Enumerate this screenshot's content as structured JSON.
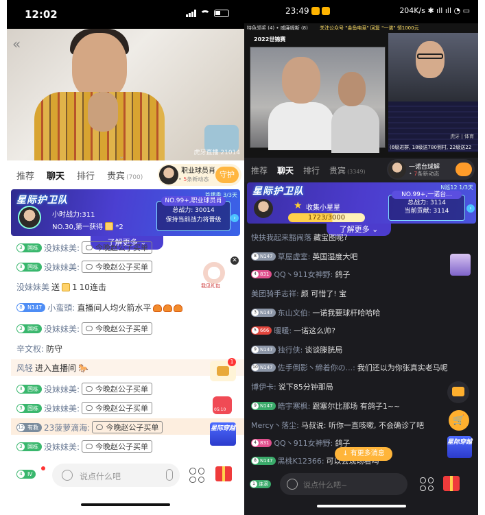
{
  "left": {
    "status": {
      "time": "12:02"
    },
    "video": {
      "watermark": "虎牙直播 21014"
    },
    "tabs": [
      {
        "label": "推荐"
      },
      {
        "label": "聊天"
      },
      {
        "label": "排行"
      },
      {
        "label": "贵宾",
        "count": "(700)"
      }
    ],
    "anchor": {
      "name": "职业球员肖",
      "new_count": "5",
      "new_suffix": "条新动态",
      "guard_label": "守护"
    },
    "banner": {
      "logo": "星际护卫队",
      "page": "首播季 3/3天",
      "hourly_power": "小时战力:311",
      "rank_line": "NO.30,第一获得",
      "rank_multiplier": "*2",
      "rank_title": "NO.99+,职业球员肖",
      "total_power": "总战力:  30014",
      "keep_text": "保持当前战力将晋级",
      "more": "了解更多"
    },
    "chat": [
      {
        "badge_lv": "3",
        "badge": "国栋",
        "user": "没妹妹美:",
        "quote": "今晚赵公子买单"
      },
      {
        "badge_lv": "3",
        "badge": "国栋",
        "user": "没妹妹美:",
        "quote": "今晚赵公子买单"
      },
      {
        "user": "没妹妹美",
        "action": "送",
        "gift_count": "1",
        "combo": "10连击"
      },
      {
        "badge_lv": "8",
        "badge": "N147",
        "user": "小蛮頭:",
        "text": "直播间人均火箭水平"
      },
      {
        "badge_lv": "3",
        "badge": "国栋",
        "user": "没妹妹美:",
        "quote": "今晚赵公子买单"
      },
      {
        "user": "辛文权:",
        "text": "防守"
      },
      {
        "user": "风轻",
        "text": "进入直播间"
      },
      {
        "badge_lv": "3",
        "badge": "国栋",
        "user": "没妹妹美:",
        "quote": "今晚赵公子买单"
      },
      {
        "badge_lv": "3",
        "badge": "国栋",
        "user": "没妹妹美:",
        "quote": "今晚赵公子买单"
      },
      {
        "badge_lv": "12",
        "badge": "有救",
        "user": "23菠萝滴海:",
        "quote": "今晚赵公子买单"
      },
      {
        "badge_lv": "3",
        "badge": "国栋",
        "user": "没妹妹美:",
        "quote": "今晚赵公子买单"
      }
    ],
    "float": {
      "gift_caption": "我见礼包",
      "chest_badge": "1",
      "redbox_caption": "05:10",
      "star_label": "星际穿越"
    },
    "input": {
      "level": "4",
      "placeholder": "说点什么吧"
    }
  },
  "right": {
    "status": {
      "time": "23:49",
      "net": "204K/s"
    },
    "video": {
      "caption": "特色领奖 (4) • 威廉姆斯 (8)",
      "promo": "关注公众号 \"金鱼电竞\" 回复 \"一诺\" 领1000元",
      "event": "2022世锦赛",
      "watermark": "虎牙 | 体育",
      "footer": "(6级进群, 18级送780到村, 22级送22"
    },
    "tabs": [
      {
        "label": "推荐"
      },
      {
        "label": "聊天"
      },
      {
        "label": "排行"
      },
      {
        "label": "贵宾",
        "count": "(3349)"
      }
    ],
    "anchor": {
      "name": "一诺台球解",
      "new_count": "7",
      "new_suffix": "条新动态"
    },
    "banner": {
      "logo": "星际护卫队",
      "page": "N巡12 1/3天",
      "collect": "收集小星星",
      "progress": "1723/3000",
      "progress_fraction": 0.574,
      "rank_title": "NO.99+,一诺台...",
      "total_power": "总战力:  3114",
      "contribution": "当前贡献:  3114",
      "more": "了解更多"
    },
    "chat": [
      {
        "user": "快扶我起来豁闹落",
        "text": "藏宝图呢?"
      },
      {
        "badge_lv": "8",
        "badge": "N147",
        "user": "草屋虚室:",
        "text": "英国湿度大吧"
      },
      {
        "badge_lv": "4",
        "badge": "831",
        "user": "QQ丶911女神野:",
        "text": "鸽子"
      },
      {
        "user": "美团骑手志祥:",
        "text": "颜  可惜了!  宝"
      },
      {
        "badge_lv": "3",
        "badge": "N147",
        "user": "东山文伯:",
        "text": "一诺我要球杆哈哈哈"
      },
      {
        "badge_lv": "5",
        "badge": "666",
        "user": "暖暖:",
        "text": "一诺这么帅?"
      },
      {
        "badge_lv": "9",
        "badge": "N147",
        "user": "独行侠:",
        "text": "谈谈滕胱局"
      },
      {
        "badge_lv": "10",
        "badge": "N147",
        "user": "佐手倒影丶締着你の...:",
        "text": "我们还以为你张真实老马呢"
      },
      {
        "user": "博伊卡:",
        "text": "说下85分钟那局"
      },
      {
        "badge_lv": "9",
        "badge": "N147",
        "user": "皓宇寒枫:",
        "text": "跟塞尔比那场  有鸽子1~~"
      },
      {
        "user": "Mercy丶落尘:",
        "text": "马叔说: 听你一直咳嗽, 不会确诊了吧"
      },
      {
        "badge_lv": "4",
        "badge": "831",
        "user": "QQ丶911女神野:",
        "text": "鸽子"
      },
      {
        "badge_lv": "8",
        "badge": "N147",
        "user": "黑桃K12366:",
        "text": "可以去现场看吗"
      }
    ],
    "float": {
      "new_messages": "有更多消息",
      "star_label": "星际穿越"
    },
    "input": {
      "level": "1",
      "level_text": "连滚",
      "placeholder": "说点什么吧~"
    }
  }
}
